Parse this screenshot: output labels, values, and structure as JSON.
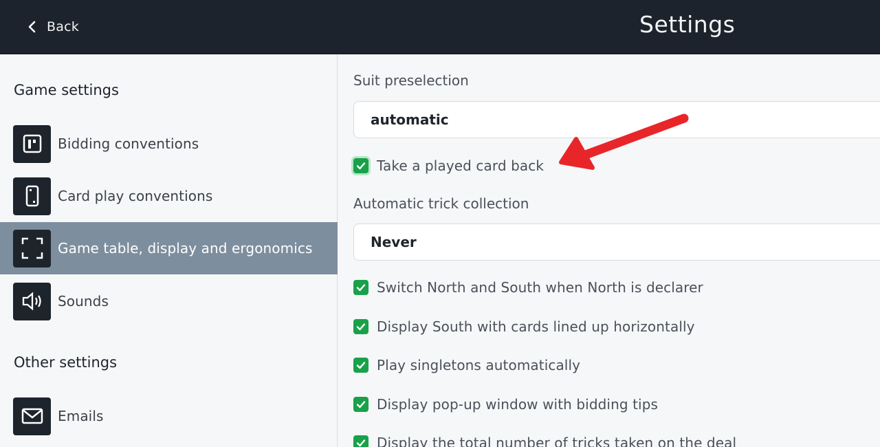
{
  "header": {
    "back_label": "Back",
    "title": "Settings"
  },
  "sidebar": {
    "game_settings_title": "Game settings",
    "other_settings_title": "Other settings",
    "items": [
      {
        "label": "Bidding conventions",
        "icon": "bidding-box-icon",
        "active": false
      },
      {
        "label": "Card play conventions",
        "icon": "card-icon",
        "active": false
      },
      {
        "label": "Game table, display and ergonomics",
        "icon": "fullscreen-frame-icon",
        "active": true
      },
      {
        "label": "Sounds",
        "icon": "speaker-icon",
        "active": false
      }
    ],
    "other_items": [
      {
        "label": "Emails",
        "icon": "envelope-icon",
        "active": false
      }
    ]
  },
  "main": {
    "suit_preselection": {
      "label": "Suit preselection",
      "value": "automatic"
    },
    "take_back": {
      "label": "Take a played card back",
      "checked": true
    },
    "trick_collection": {
      "label": "Automatic trick collection",
      "value": "Never"
    },
    "options": [
      {
        "label": "Switch North and South when North is declarer",
        "checked": true
      },
      {
        "label": "Display South with cards lined up horizontally",
        "checked": true
      },
      {
        "label": "Play singletons automatically",
        "checked": true
      },
      {
        "label": "Display pop-up window with bidding tips",
        "checked": true
      },
      {
        "label": "Display the total number of tricks taken on the deal",
        "checked": true
      }
    ]
  },
  "colors": {
    "topbar": "#1d232c",
    "active_item": "#7d8e9e",
    "checkbox": "#19a14a",
    "annotation_arrow": "#e8262a"
  }
}
